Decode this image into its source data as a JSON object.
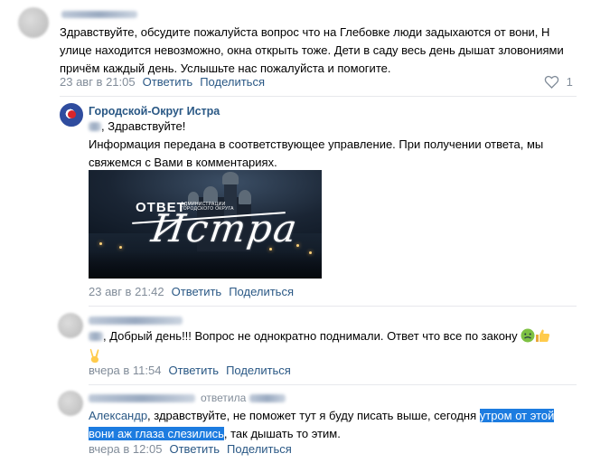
{
  "comments": [
    {
      "text": "Здравствуйте, обсудите пожалуйста вопрос что на Глебовке люди задыхаются от вони, Н улице находится невозможно, окна открыть тоже. Дети в саду весь день дышат зловониями причём каждый день. Услышьте нас пожалуйста и помогите.",
      "date": "23 авг в 21:05",
      "reply": "Ответить",
      "share": "Поделиться",
      "likes": "1"
    },
    {
      "author": "Городской-Округ Истра",
      "greeting": ", Здравствуйте!",
      "text": "Информация передана в соответствующее управление. При получении ответа, мы свяжемся с Вами в комментариях.",
      "banner": {
        "title": "ОТВЕТ",
        "subtitle": "АДМИНИСТРАЦИИ ГОРОДСКОГО ОКРУГА",
        "script": "Истра"
      },
      "date": "23 авг в 21:42",
      "reply": "Ответить",
      "share": "Поделиться"
    },
    {
      "text": ", Добрый день!!! Вопрос не однократно поднимали. Ответ что все по закону",
      "date": "вчера в 11:54",
      "reply": "Ответить",
      "share": "Поделиться"
    },
    {
      "reply_label": "ответила",
      "mention": "Александр",
      "text_before": ", здравствуйте, не поможет тут я буду писать выше, сегодня",
      "highlight_1": "утром от этой",
      "highlight_2": "вони аж глаза слезились",
      "text_after": ", так дышать то этим.",
      "date": "вчера в 12:05",
      "reply": "Ответить",
      "share": "Поделиться"
    }
  ],
  "icons": [
    "heart-icon",
    "nauseated-face-icon",
    "thumbs-up-icon",
    "victory-hand-icon"
  ],
  "colors": {
    "link": "#2a5885",
    "meta": "#818c99",
    "highlight": "#1d7ce0"
  }
}
